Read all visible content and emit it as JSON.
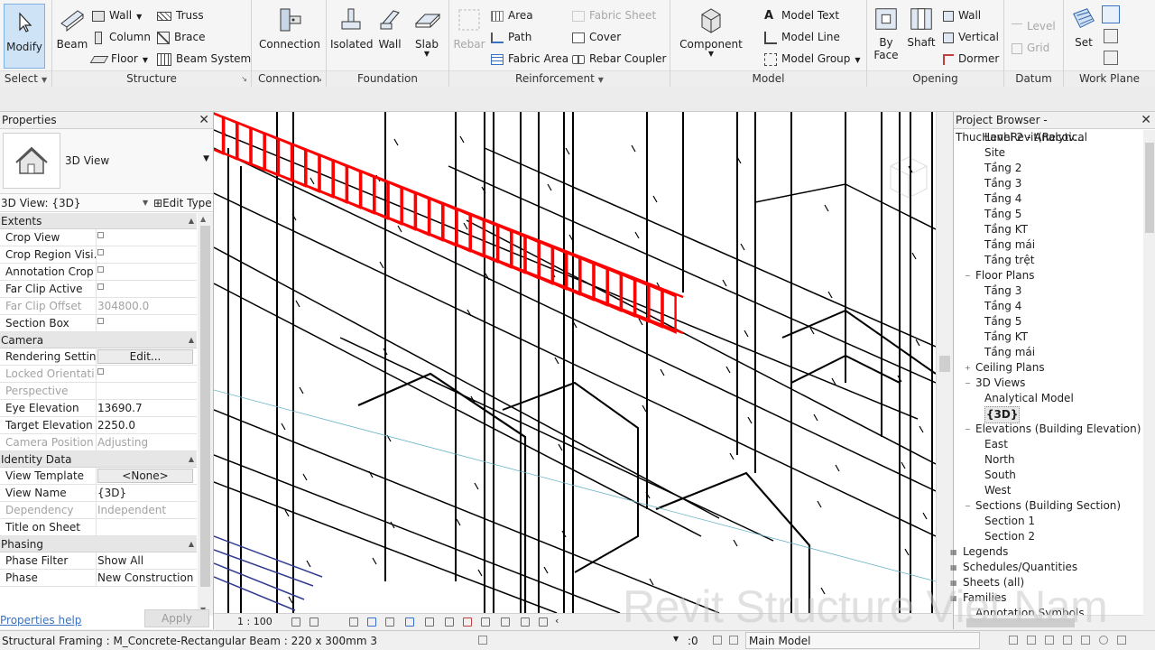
{
  "ribbon": {
    "modify_label": "Modify",
    "select_label": "Select",
    "structure": {
      "beam": "Beam",
      "wall": "Wall",
      "column": "Column",
      "floor": "Floor",
      "truss": "Truss",
      "brace": "Brace",
      "beam_system": "Beam  System",
      "label": "Structure"
    },
    "connection": {
      "connection": "Connection",
      "label": "Connection"
    },
    "foundation": {
      "isolated": "Isolated",
      "wall": "Wall",
      "slab": "Slab",
      "label": "Foundation"
    },
    "reinforcement": {
      "rebar": "Rebar",
      "area": "Area",
      "path": "Path",
      "fabric_area": "Fabric  Area",
      "fabric_sheet": "Fabric  Sheet",
      "cover": "Cover",
      "rebar_coupler": "Rebar  Coupler",
      "label": "Reinforcement"
    },
    "model": {
      "component": "Component",
      "model_text": "Model  Text",
      "model_line": "Model  Line",
      "model_group": "Model  Group",
      "label": "Model"
    },
    "opening": {
      "by_face": "By\nFace",
      "shaft": "Shaft",
      "wall": "Wall",
      "vertical": "Vertical",
      "dormer": "Dormer",
      "label": "Opening"
    },
    "datum": {
      "level": "Level",
      "grid": "Grid",
      "label": "Datum"
    },
    "work_plane": {
      "set": "Set",
      "label": "Work Plane"
    }
  },
  "properties": {
    "title": "Properties",
    "type_name": "3D View",
    "instance": "3D View: {3D}",
    "edit_type": "Edit Type",
    "sections": [
      {
        "name": "Extents",
        "rows": [
          {
            "key": "Crop View",
            "value": "",
            "checkbox": true,
            "gray": false
          },
          {
            "key": "Crop Region Visi...",
            "value": "",
            "checkbox": true,
            "gray": false
          },
          {
            "key": "Annotation Crop",
            "value": "",
            "checkbox": true,
            "gray": false
          },
          {
            "key": "Far Clip Active",
            "value": "",
            "checkbox": true,
            "gray": false
          },
          {
            "key": "Far Clip Offset",
            "value": "304800.0",
            "checkbox": false,
            "gray": true
          },
          {
            "key": "Section Box",
            "value": "",
            "checkbox": true,
            "gray": false
          }
        ]
      },
      {
        "name": "Camera",
        "rows": [
          {
            "key": "Rendering Settin...",
            "value": "Edit...",
            "button": true,
            "gray": false
          },
          {
            "key": "Locked Orientati...",
            "value": "",
            "checkbox": true,
            "gray": true
          },
          {
            "key": "Perspective",
            "value": "",
            "checkbox": false,
            "gray": true
          },
          {
            "key": "Eye Elevation",
            "value": "13690.7",
            "gray": false
          },
          {
            "key": "Target Elevation",
            "value": "2250.0",
            "gray": false
          },
          {
            "key": "Camera Position",
            "value": "Adjusting",
            "gray": true
          }
        ]
      },
      {
        "name": "Identity Data",
        "rows": [
          {
            "key": "View Template",
            "value": "<None>",
            "button": true,
            "gray": false
          },
          {
            "key": "View Name",
            "value": "{3D}",
            "gray": false
          },
          {
            "key": "Dependency",
            "value": "Independent",
            "gray": true
          },
          {
            "key": "Title on Sheet",
            "value": "",
            "gray": false
          }
        ]
      },
      {
        "name": "Phasing",
        "rows": [
          {
            "key": "Phase Filter",
            "value": "Show All",
            "gray": false
          },
          {
            "key": "Phase",
            "value": "New Construction",
            "gray": false
          }
        ]
      }
    ],
    "help_link": "Properties help",
    "apply": "Apply"
  },
  "browser": {
    "title": "Project Browser - ThucHanhRevit(Recov...",
    "items": [
      {
        "text": "Level 2 - Analytical",
        "level": 2
      },
      {
        "text": "Site",
        "level": 2
      },
      {
        "text": "Tầng 2",
        "level": 2
      },
      {
        "text": "Tầng 3",
        "level": 2
      },
      {
        "text": "Tầng 4",
        "level": 2
      },
      {
        "text": "Tầng 5",
        "level": 2
      },
      {
        "text": "Tầng KT",
        "level": 2
      },
      {
        "text": "Tầng mái",
        "level": 2
      },
      {
        "text": "Tầng trệt",
        "level": 2
      },
      {
        "text": "Floor Plans",
        "level": 1,
        "twist": "−"
      },
      {
        "text": "Tầng 3",
        "level": 2
      },
      {
        "text": "Tầng 4",
        "level": 2
      },
      {
        "text": "Tầng 5",
        "level": 2
      },
      {
        "text": "Tầng KT",
        "level": 2
      },
      {
        "text": "Tầng mái",
        "level": 2
      },
      {
        "text": "Ceiling Plans",
        "level": 1,
        "twist": "+"
      },
      {
        "text": "3D Views",
        "level": 1,
        "twist": "−"
      },
      {
        "text": "Analytical Model",
        "level": 2
      },
      {
        "text": "{3D}",
        "level": 2,
        "selected": true
      },
      {
        "text": "Elevations (Building Elevation)",
        "level": 1,
        "twist": "−"
      },
      {
        "text": "East",
        "level": 2
      },
      {
        "text": "North",
        "level": 2
      },
      {
        "text": "South",
        "level": 2
      },
      {
        "text": "West",
        "level": 2
      },
      {
        "text": "Sections (Building Section)",
        "level": 1,
        "twist": "−"
      },
      {
        "text": "Section 1",
        "level": 2
      },
      {
        "text": "Section 2",
        "level": 2
      },
      {
        "text": "Legends",
        "level": 0,
        "twist": "▦"
      },
      {
        "text": "Schedules/Quantities",
        "level": 0,
        "twist": "▦"
      },
      {
        "text": "Sheets (all)",
        "level": 0,
        "twist": "▦"
      },
      {
        "text": "Families",
        "level": 0,
        "twist": "▦"
      },
      {
        "text": "Annotation Symbols",
        "level": 1
      }
    ]
  },
  "viewbar": {
    "scale": "1 : 100"
  },
  "status": {
    "message": "Structural Framing : M_Concrete-Rectangular Beam : 220 x 300mm 3",
    "zero": ":0",
    "model": "Main Model"
  },
  "watermark": "Revit Structure Viet Nam",
  "colors": {
    "accent": "#cfe3f7",
    "rebar": "#ff0000",
    "link": "#3a72c2"
  }
}
